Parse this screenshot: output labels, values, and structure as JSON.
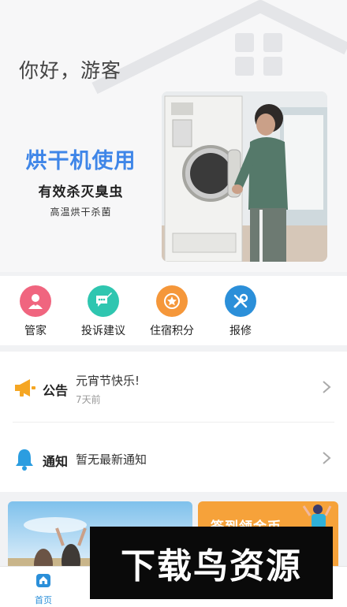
{
  "header": {
    "greeting": "你好，游客"
  },
  "banner": {
    "title": "烘干机使用",
    "subtitle": "有效杀灭臭虫",
    "caption": "高温烘干杀菌"
  },
  "quick_actions": [
    {
      "label": "管家",
      "icon": "butler-icon",
      "color": "#f0657f"
    },
    {
      "label": "投诉建议",
      "icon": "chat-edit-icon",
      "color": "#2fc6b0"
    },
    {
      "label": "住宿积分",
      "icon": "star-badge-icon",
      "color": "#f5973a"
    },
    {
      "label": "报修",
      "icon": "wrench-icon",
      "color": "#2b8fd9"
    }
  ],
  "announcement": {
    "title": "公告",
    "message": "元宵节快乐!",
    "time": "7天前"
  },
  "notification": {
    "title": "通知",
    "message": "暂无最新通知"
  },
  "promo": {
    "right_text": "签到领金币"
  },
  "watermark": {
    "text": "下载鸟资源"
  },
  "tabs": [
    {
      "label": "首页",
      "icon": "home-icon",
      "active": true
    },
    {
      "label": "",
      "icon": "tab-2-icon",
      "active": false
    },
    {
      "label": "",
      "icon": "tab-3-icon",
      "active": false
    },
    {
      "label": "",
      "icon": "tab-4-icon",
      "active": false
    }
  ],
  "colors": {
    "accent": "#2b8fd9",
    "banner_title": "#3f86e8",
    "announce_icon": "#f5a623",
    "notify_icon": "#2b9de0"
  }
}
